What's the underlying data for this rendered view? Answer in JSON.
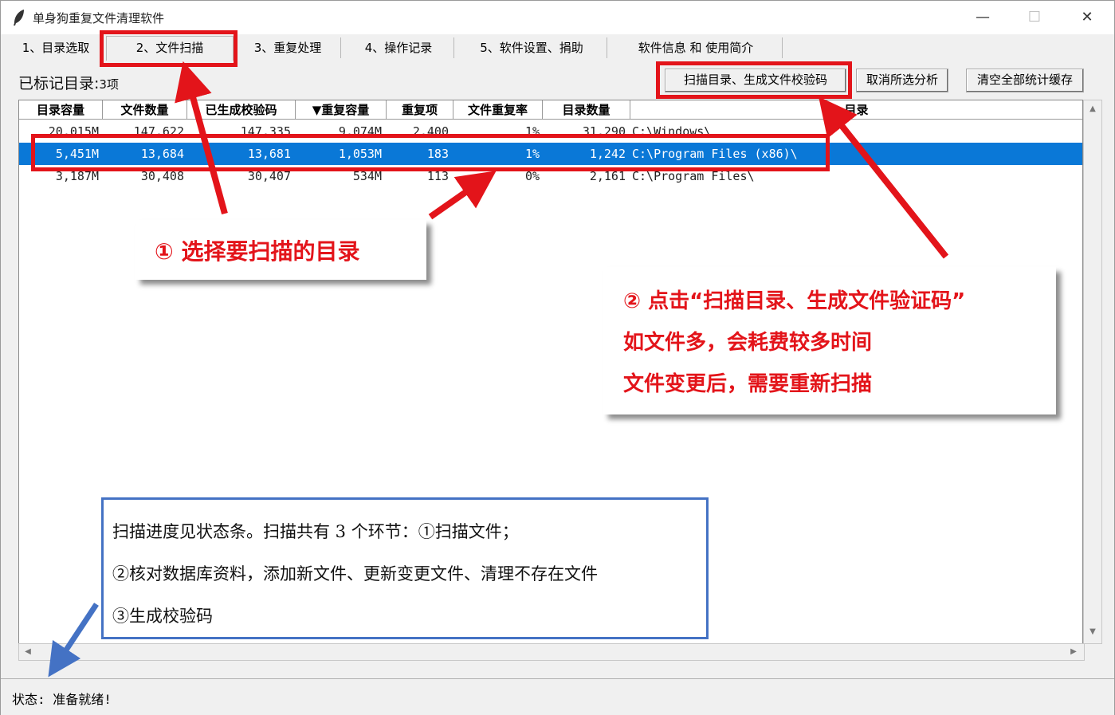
{
  "window": {
    "title": "单身狗重复文件清理软件",
    "minimize": "—",
    "maximize": "☐",
    "close": "✕"
  },
  "tabs": [
    {
      "label": "1、目录选取"
    },
    {
      "label": "2、文件扫描",
      "active": true
    },
    {
      "label": "3、重复处理"
    },
    {
      "label": "4、操作记录"
    },
    {
      "label": "5、软件设置、捐助"
    },
    {
      "label": "软件信息 和 使用简介"
    }
  ],
  "marked": {
    "label": "已标记目录:",
    "count": "3项"
  },
  "buttons": {
    "scan": "扫描目录、生成文件校验码",
    "cancel": "取消所选分析",
    "clear": "清空全部统计缓存"
  },
  "columns": [
    "目录容量",
    "文件数量",
    "已生成校验码",
    "▼重复容量",
    "重复项",
    "文件重复率",
    "目录数量",
    "目录"
  ],
  "rows": [
    {
      "size": "20,015M",
      "files": "147,622",
      "hashed": "147,335",
      "dup_size": "9,074M",
      "dup_items": "2,400",
      "dup_rate": "1%",
      "dirs": "31,290",
      "path": "C:\\Windows\\",
      "selected": false
    },
    {
      "size": "5,451M",
      "files": "13,684",
      "hashed": "13,681",
      "dup_size": "1,053M",
      "dup_items": "183",
      "dup_rate": "1%",
      "dirs": "1,242",
      "path": "C:\\Program Files (x86)\\",
      "selected": true
    },
    {
      "size": "3,187M",
      "files": "30,408",
      "hashed": "30,407",
      "dup_size": "534M",
      "dup_items": "113",
      "dup_rate": "0%",
      "dirs": "2,161",
      "path": "C:\\Program Files\\",
      "selected": false
    }
  ],
  "status": {
    "text": "状态: 准备就绪!"
  },
  "callouts": {
    "one": "① 选择要扫描的目录",
    "two": [
      "② 点击“扫描目录、生成文件验证码”",
      "如文件多，会耗费较多时间",
      "文件变更后，需要重新扫描"
    ],
    "three": [
      "扫描进度见状态条。扫描共有 3 个环节：①扫描文件；",
      "②核对数据库资料，添加新文件、更新变更文件、清理不存在文件",
      "③生成校验码"
    ]
  },
  "colors": {
    "accent_red": "#e3141a",
    "accent_blue": "#4472c4",
    "selection": "#0a78d7"
  }
}
